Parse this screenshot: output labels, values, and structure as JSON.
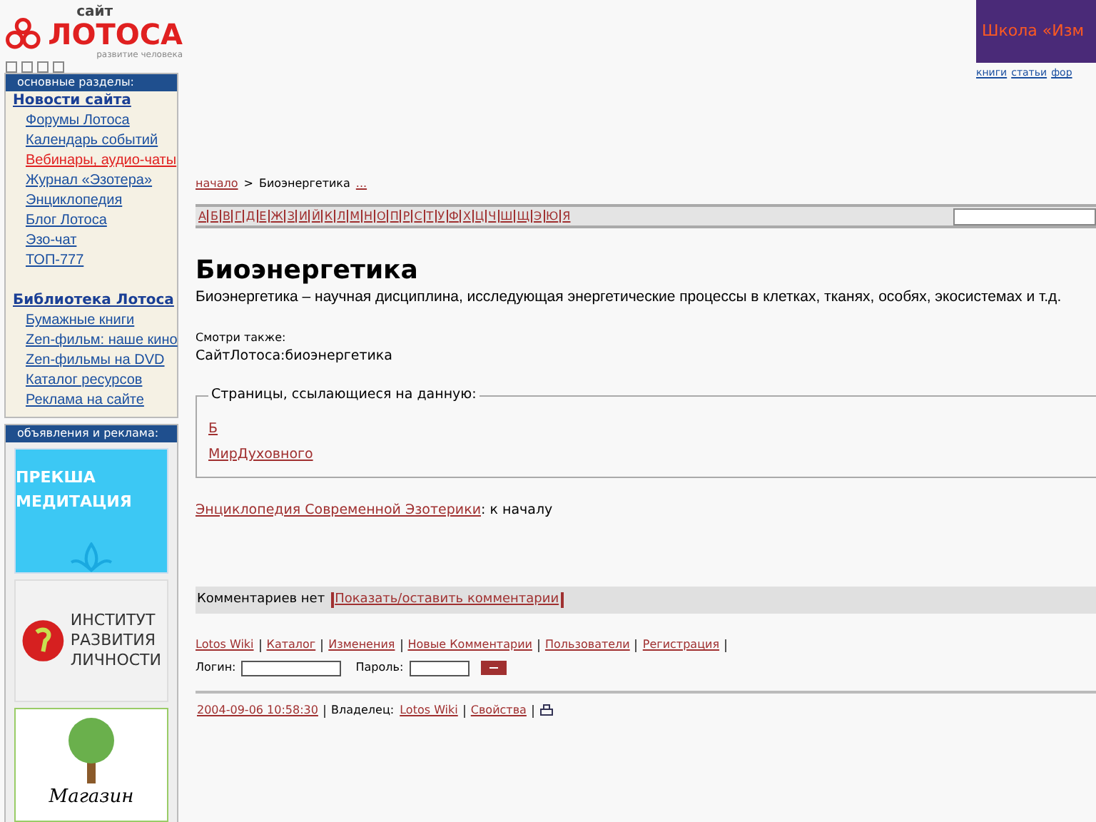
{
  "logo": {
    "small": "сайт",
    "big": "ЛОТОСА",
    "tagline": "развитие человека"
  },
  "top_banner": {
    "title": "Школа «Изм",
    "links": [
      "книги",
      "статьи",
      "фор"
    ]
  },
  "sidebar": {
    "main_heading": "основные разделы:",
    "groups": [
      {
        "title": "Новости сайта",
        "items": [
          {
            "label": "Форумы Лотоса",
            "highlighted": false
          },
          {
            "label": "Календарь событий",
            "highlighted": false
          },
          {
            "label": "Вебинары, аудио-чаты",
            "highlighted": true
          },
          {
            "label": "Журнал «Эзотера»",
            "highlighted": false
          },
          {
            "label": "Энциклопедия",
            "highlighted": false
          },
          {
            "label": "Блог Лотоса",
            "highlighted": false
          },
          {
            "label": "Эзо-чат",
            "highlighted": false
          },
          {
            "label": "ТОП-777",
            "highlighted": false
          }
        ]
      },
      {
        "title": "Библиотека Лотоса",
        "items": [
          {
            "label": "Бумажные книги",
            "highlighted": false
          },
          {
            "label": "Zen-фильм: наше кино",
            "highlighted": false
          },
          {
            "label": "Zen-фильмы на DVD",
            "highlighted": false
          },
          {
            "label": "Каталог ресурсов",
            "highlighted": false
          },
          {
            "label": "Реклама на сайте",
            "highlighted": false
          }
        ]
      }
    ],
    "ads_heading": "объявления и реклама:",
    "ads": [
      {
        "kind": "meditation",
        "text": "ПРЕКША МЕДИТАЦИЯ"
      },
      {
        "kind": "institute",
        "text": "ИНСТИТУТ РАЗВИТИЯ ЛИЧНОСТИ"
      },
      {
        "kind": "shop",
        "text": "Магазин"
      }
    ]
  },
  "breadcrumb": {
    "link": "начало",
    "sep": ">",
    "current": "Биоэнергетика",
    "more": "..."
  },
  "alphabet": [
    "А",
    "Б",
    "В",
    "Г",
    "Д",
    "Е",
    "Ж",
    "З",
    "И",
    "Й",
    "К",
    "Л",
    "М",
    "Н",
    "О",
    "П",
    "Р",
    "С",
    "Т",
    "У",
    "Ф",
    "Х",
    "Ц",
    "Ч",
    "Ш",
    "Щ",
    "Э",
    "Ю",
    "Я"
  ],
  "article": {
    "title": "Биоэнергетика",
    "text": "Биоэнергетика – научная дисциплина, исследующая энергетические процессы в клетках, тканях, особях, экосистемах и т.д.",
    "see_also_label": "Смотри также:",
    "see_also": "СайтЛотоса:биоэнергетика"
  },
  "backlinks": {
    "legend": "Страницы, ссылающиеся на данную:",
    "links": [
      "Б",
      "МирДуховного"
    ]
  },
  "encyclopedia": {
    "link": "Энциклопедия Современной Эзотерики",
    "tail": ": к началу"
  },
  "comments": {
    "text": "Комментариев нет",
    "link": "Показать/оставить комментарии"
  },
  "footer_links": [
    "Lotos Wiki",
    "Каталог",
    "Изменения",
    "Новые Комментарии",
    "Пользователи",
    "Регистрация"
  ],
  "login": {
    "login_label": "Логин:",
    "password_label": "Пароль:"
  },
  "meta": {
    "date": "2004-09-06 10:58:30",
    "owner_label": "Владелец:",
    "owner": "Lotos Wiki",
    "properties": "Свойства"
  }
}
